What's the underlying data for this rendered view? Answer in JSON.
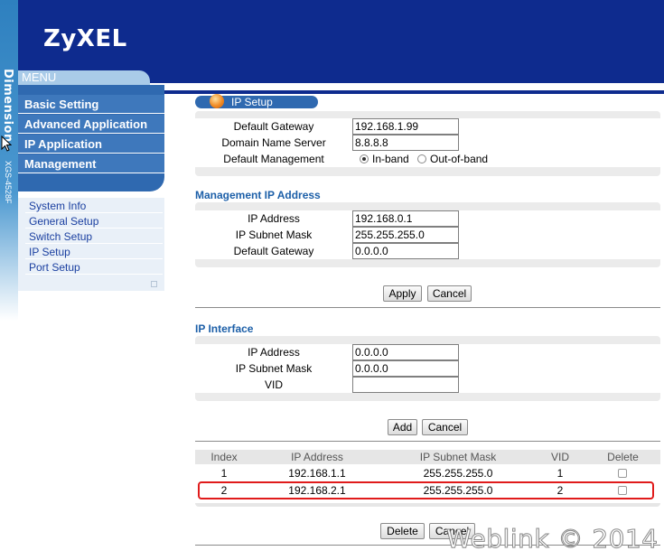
{
  "brand": {
    "logo": "ZyXEL",
    "vertical_brand": "Dimension",
    "vertical_model": "XGS-4528F"
  },
  "menu": {
    "header": "MENU",
    "items": [
      {
        "label": "Basic Setting"
      },
      {
        "label": "Advanced Application"
      },
      {
        "label": "IP Application"
      },
      {
        "label": "Management"
      }
    ],
    "submenu": [
      {
        "label": "System Info"
      },
      {
        "label": "General Setup"
      },
      {
        "label": "Switch Setup"
      },
      {
        "label": "IP Setup"
      },
      {
        "label": "Port Setup"
      }
    ]
  },
  "ip_setup": {
    "title": "IP Setup",
    "default_gateway_label": "Default Gateway",
    "default_gateway_value": "192.168.1.99",
    "dns_label": "Domain Name Server",
    "dns_value": "8.8.8.8",
    "default_management_label": "Default Management",
    "option_inband": "In-band",
    "option_outofband": "Out-of-band",
    "selected_option": "In-band"
  },
  "management_ip": {
    "title": "Management IP Address",
    "ip_label": "IP Address",
    "ip_value": "192.168.0.1",
    "mask_label": "IP Subnet Mask",
    "mask_value": "255.255.255.0",
    "gateway_label": "Default Gateway",
    "gateway_value": "0.0.0.0",
    "apply_label": "Apply",
    "cancel_label": "Cancel"
  },
  "ip_interface": {
    "title": "IP Interface",
    "ip_label": "IP Address",
    "ip_value": "0.0.0.0",
    "mask_label": "IP Subnet Mask",
    "mask_value": "0.0.0.0",
    "vid_label": "VID",
    "vid_value": "",
    "add_label": "Add",
    "cancel_label": "Cancel"
  },
  "table": {
    "columns": [
      "Index",
      "IP Address",
      "IP Subnet Mask",
      "VID",
      "Delete"
    ],
    "rows": [
      {
        "index": "1",
        "ip": "192.168.1.1",
        "mask": "255.255.255.0",
        "vid": "1"
      },
      {
        "index": "2",
        "ip": "192.168.2.1",
        "mask": "255.255.255.0",
        "vid": "2"
      }
    ],
    "delete_label": "Delete",
    "cancel_label": "Cancel"
  },
  "watermark": "Weblink © 2014",
  "colors": {
    "header_blue": "#0e2b8e",
    "menu_blue": "#3e78bc",
    "section_title": "#1c5fa8",
    "highlight_red": "#e01b1b"
  }
}
